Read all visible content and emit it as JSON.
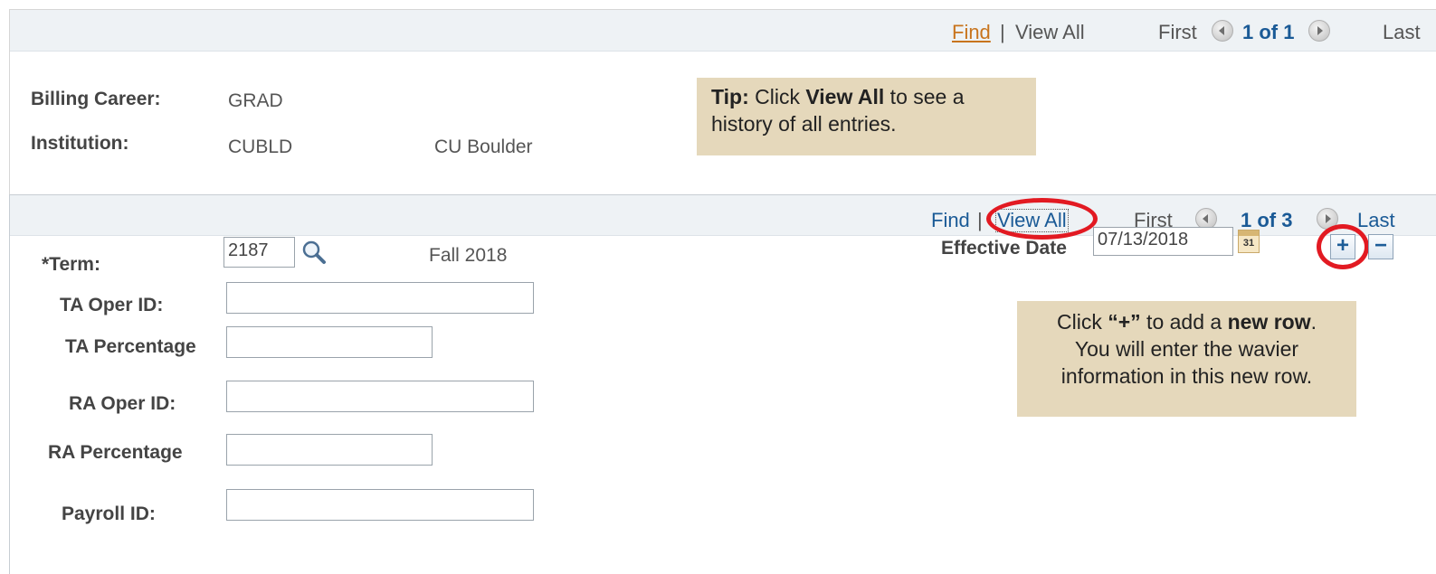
{
  "outer_nav": {
    "find": "Find",
    "separator": "|",
    "view_all": "View All",
    "first": "First",
    "count": "1 of 1",
    "last": "Last"
  },
  "header_fields": {
    "billing_career_label": "Billing Career:",
    "billing_career_value": "GRAD",
    "institution_label": "Institution:",
    "institution_code": "CUBLD",
    "institution_name": "CU Boulder"
  },
  "tip_view_all": {
    "prefix": "Tip:",
    "text1": " Click ",
    "emph": "View All",
    "text2": " to see a",
    "line2": "history of all entries."
  },
  "inner_nav": {
    "find": "Find",
    "separator": "|",
    "view_all": "View All",
    "first": "First",
    "count": "1 of 3",
    "last": "Last"
  },
  "form": {
    "term_label": "*Term:",
    "term_value": "2187",
    "term_description": "Fall 2018",
    "effective_date_label": "Effective Date",
    "effective_date_value": "07/13/2018",
    "calendar_icon_text": "31",
    "add_row_symbol": "+",
    "delete_row_symbol": "−",
    "ta_oper_id_label": "TA Oper ID:",
    "ta_oper_id_value": "",
    "ta_percentage_label": "TA Percentage",
    "ta_percentage_value": "",
    "ra_oper_id_label": "RA Oper ID:",
    "ra_oper_id_value": "",
    "ra_percentage_label": "RA Percentage",
    "ra_percentage_value": "",
    "payroll_id_label": "Payroll ID:",
    "payroll_id_value": ""
  },
  "tip_add_row": {
    "l1_a": "Click ",
    "l1_b": "“+”",
    "l1_c": " to add a ",
    "l1_d": "new row",
    "l1_e": ".",
    "line2": "You will enter the wavier",
    "line3": "information in this new row."
  },
  "icons": {
    "search": "magnifier-icon",
    "calendar": "calendar-icon",
    "prev": "previous-arrow-icon",
    "next": "next-arrow-icon"
  },
  "colors": {
    "link_blue": "#1a5a96",
    "find_orange": "#c8741d",
    "highlight_red": "#e21a22",
    "tip_background": "#e5d8bb",
    "header_background": "#eef2f5"
  }
}
